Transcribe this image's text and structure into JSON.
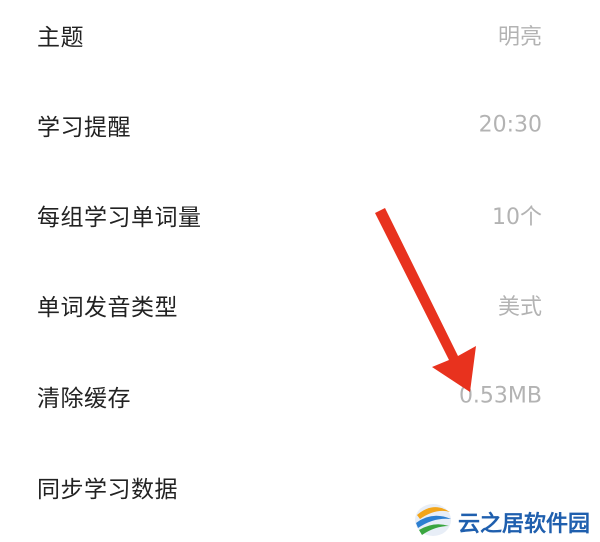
{
  "settings": [
    {
      "label": "主题",
      "value": "明亮"
    },
    {
      "label": "学习提醒",
      "value": "20:30"
    },
    {
      "label": "每组学习单词量",
      "value": "10个"
    },
    {
      "label": "单词发音类型",
      "value": "美式"
    },
    {
      "label": "清除缓存",
      "value": "0.53MB"
    },
    {
      "label": "同步学习数据",
      "value": ""
    }
  ],
  "watermark": {
    "text": "云之居软件园",
    "icon": "yunzhiju-logo-icon"
  },
  "annotation": {
    "icon": "red-arrow-icon",
    "color": "#e8321e"
  },
  "colors": {
    "label": "#222222",
    "value": "#b3b3b3",
    "watermark": "#1f5fae"
  }
}
